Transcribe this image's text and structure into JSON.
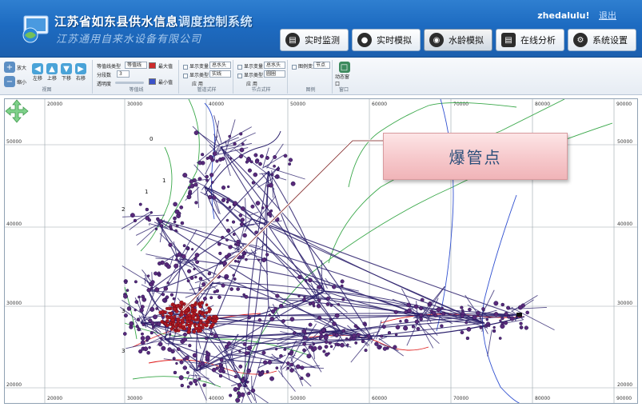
{
  "header": {
    "title_main": "江苏省如东县供水信息",
    "title_highlight": "调度控制系统",
    "subtitle": "江苏通用自来水设备有限公司",
    "user_name": "zhedalulu!",
    "logout_label": "退出"
  },
  "nav": [
    {
      "label": "实时监测",
      "icon": "monitor-icon"
    },
    {
      "label": "实时模拟",
      "icon": "bulb-icon"
    },
    {
      "label": "水龄模拟",
      "icon": "eye-icon"
    },
    {
      "label": "在线分析",
      "icon": "chart-icon"
    },
    {
      "label": "系统设置",
      "icon": "gear-icon"
    }
  ],
  "nav_active_index": 2,
  "ribbon": {
    "view": {
      "label": "视图",
      "zoom_in": "放大",
      "zoom_out": "缩小",
      "left": "左移",
      "up": "上移",
      "down": "下移",
      "right": "右移"
    },
    "contour": {
      "label": "等值线",
      "type_label": "等值线类型",
      "type_value": "等值线",
      "levels_label": "分段数",
      "levels_value": "3",
      "transparency_label": "透明度",
      "max_label": "最大值",
      "min_label": "最小值"
    },
    "pipe_style": {
      "label": "管道式样",
      "show_var": "显示变量",
      "show_var_value": "总水头",
      "show_type": "显示类型",
      "show_type_value": "实线",
      "apply": "应 用"
    },
    "node_style": {
      "label": "节点式样",
      "show_var": "显示变量",
      "show_var_value": "总水头",
      "show_type": "显示类型",
      "show_type_value": "圆圈",
      "apply": "应 用"
    },
    "legend": {
      "label": "图例",
      "legend_var": "图例变量",
      "legend_value": "节点"
    },
    "window": {
      "label": "窗口",
      "float_window": "动态窗口"
    }
  },
  "map": {
    "x_ticks": [
      "20000",
      "30000",
      "40000",
      "50000",
      "60000",
      "70000",
      "80000",
      "90000"
    ],
    "y_ticks": [
      "50000",
      "40000",
      "30000",
      "20000"
    ],
    "zone_labels": [
      "0",
      "1",
      "2",
      "1",
      "3",
      "3"
    ],
    "callout": "爆管点"
  },
  "colors": {
    "header_bg": "#1d6bc1",
    "pipe_main": "#2a1f6b",
    "pipe_red": "#e02020",
    "contour_green": "#3aa84a",
    "contour_blue": "#3050d0",
    "burst_node": "#b01822",
    "callout_bg": "#f6c8cb"
  }
}
